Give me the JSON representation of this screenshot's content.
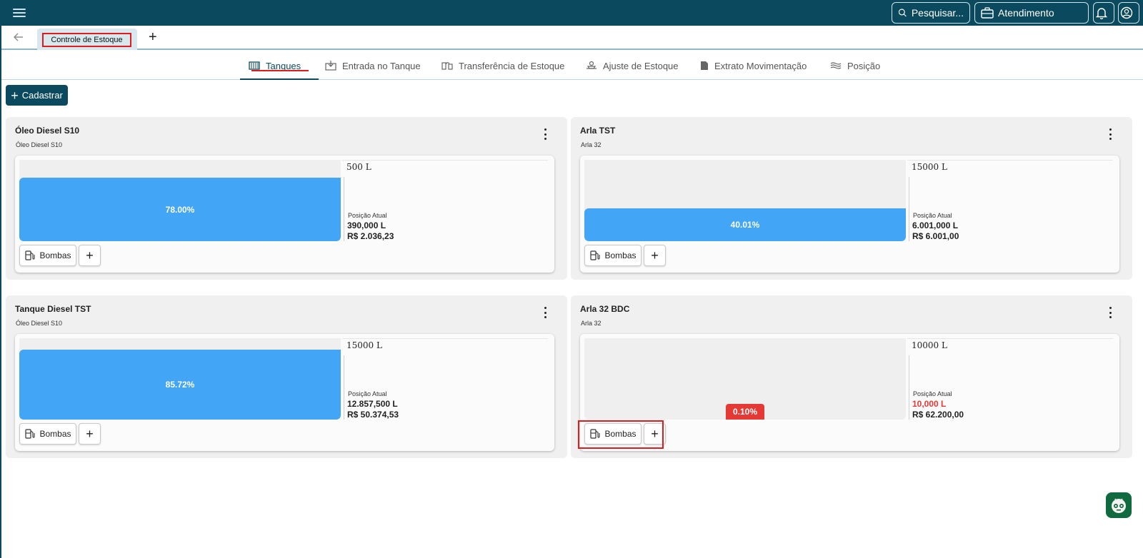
{
  "topbar": {
    "search_label": "Pesquisar...",
    "attend_label": "Atendimento"
  },
  "tabs": {
    "open_tab": "Controle de Estoque"
  },
  "nav": {
    "items": [
      {
        "label": "Tanques",
        "icon": "tank-icon"
      },
      {
        "label": "Entrada no Tanque",
        "icon": "inbound-icon"
      },
      {
        "label": "Transferência de Estoque",
        "icon": "transfer-icon"
      },
      {
        "label": "Ajuste de Estoque",
        "icon": "adjust-icon"
      },
      {
        "label": "Extrato Movimentação",
        "icon": "document-icon"
      },
      {
        "label": "Posição",
        "icon": "waves-icon"
      }
    ],
    "active": "Tanques"
  },
  "actions": {
    "register_label": "Cadastrar"
  },
  "tanks": [
    {
      "title": "Óleo Diesel S10",
      "product": "Óleo Diesel S10",
      "capacity": "500 L",
      "fill_percent": 78.0,
      "fill_label": "78.00%",
      "position_label": "Posição Atual",
      "position_liters": "390,000 L",
      "position_value": "R$ 2.036,23",
      "pumps_label": "Bombas"
    },
    {
      "title": "Arla TST",
      "product": "Arla 32",
      "capacity": "15000 L",
      "fill_percent": 40.01,
      "fill_label": "40.01%",
      "position_label": "Posição Atual",
      "position_liters": "6.001,000 L",
      "position_value": "R$ 6.001,00",
      "pumps_label": "Bombas"
    },
    {
      "title": "Tanque Diesel TST",
      "product": "Óleo Diesel S10",
      "capacity": "15000 L",
      "fill_percent": 85.72,
      "fill_label": "85.72%",
      "position_label": "Posição Atual",
      "position_liters": "12.857,500 L",
      "position_value": "R$ 50.374,53",
      "pumps_label": "Bombas"
    },
    {
      "title": "Arla 32 BDC",
      "product": "Arla 32",
      "capacity": "10000 L",
      "fill_percent": 0.1,
      "fill_label": "0.10%",
      "position_label": "Posição Atual",
      "position_liters": "10,000 L",
      "position_value": "R$ 62.200,00",
      "pumps_label": "Bombas",
      "low_level": true
    }
  ],
  "colors": {
    "brand": "#0b4a5e",
    "fill": "#42a5f5",
    "alert": "#e53935"
  }
}
